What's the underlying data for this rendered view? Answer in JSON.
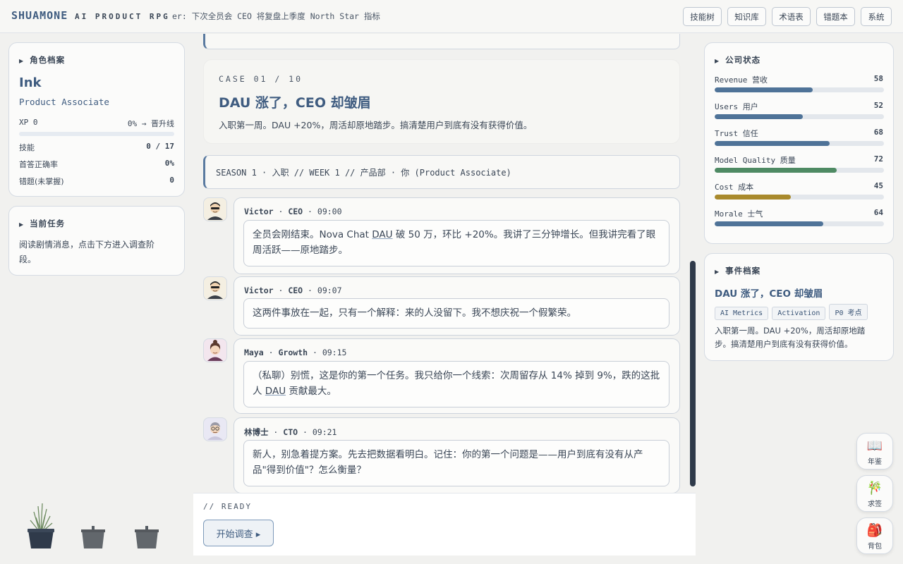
{
  "topbar": {
    "brand": "SHUAMONE",
    "brand_sub": "AI PRODUCT RPG",
    "ticker": "er: 下次全员会 CEO 将复盘上季度 North Star 指标",
    "buttons": [
      "技能树",
      "知识库",
      "术语表",
      "错题本",
      "系统"
    ]
  },
  "profile": {
    "title": "角色档案",
    "name": "Ink",
    "role": "Product Associate",
    "xp_label": "XP 0",
    "xp_progress": "0% → 晋升线",
    "xp_fraction": 0,
    "rows": [
      {
        "label": "技能",
        "value": "0 / 17"
      },
      {
        "label": "首答正确率",
        "value": "0%"
      },
      {
        "label": "错题(未掌握)",
        "value": "0"
      }
    ]
  },
  "task": {
    "title": "当前任务",
    "text": "阅读剧情消息，点击下方进入调查阶段。"
  },
  "case": {
    "number": "CASE 01 / 10",
    "title": "DAU 涨了，CEO 却皱眉",
    "desc": "入职第一周。DAU +20%，周活却原地踏步。搞清楚用户到底有没有获得价值。"
  },
  "season": "SEASON 1 · 入职 // WEEK 1 // 产品部 · 你 (Product Associate)",
  "messages": [
    {
      "name": "Victor",
      "dept": "CEO",
      "time": "09:00",
      "avatar": "victor-avatar",
      "text_a": "全员会刚结束。Nova Chat ",
      "text_u": "DAU",
      "text_b": " 破 50 万，环比 +20%。我讲了三分钟增长。但我讲完看了眼周活跃——原地踏步。"
    },
    {
      "name": "Victor",
      "dept": "CEO",
      "time": "09:07",
      "avatar": "victor-avatar",
      "text_a": "这两件事放在一起，只有一个解释：来的人没留下。我不想庆祝一个假繁荣。",
      "text_u": "",
      "text_b": ""
    },
    {
      "name": "Maya",
      "dept": "Growth",
      "time": "09:15",
      "avatar": "maya-avatar",
      "text_a": "（私聊）别慌，这是你的第一个任务。我只给你一个线索：次周留存从 14% 掉到 9%，跌的这批人 ",
      "text_u": "DAU",
      "text_b": " 贡献最大。"
    },
    {
      "name": "林博士",
      "dept": "CTO",
      "time": "09:21",
      "avatar": "lin-avatar",
      "text_a": "新人，别急着提方案。先去把数据看明白。记住：你的第一个问题是——用户到底有没有从产品\"得到价值\"？怎么衡量？",
      "text_u": "",
      "text_b": ""
    }
  ],
  "footer": {
    "status": "// READY",
    "start_button": "开始调查 ▸"
  },
  "company": {
    "title": "公司状态",
    "metrics": [
      {
        "label": "Revenue 营收",
        "value": 58,
        "color": "#4f7398"
      },
      {
        "label": "Users 用户",
        "value": 52,
        "color": "#4f7398"
      },
      {
        "label": "Trust 信任",
        "value": 68,
        "color": "#4f7398"
      },
      {
        "label": "Model Quality 质量",
        "value": 72,
        "color": "#4e8a63"
      },
      {
        "label": "Cost 成本",
        "value": 45,
        "color": "#a98a2c"
      },
      {
        "label": "Morale 士气",
        "value": 64,
        "color": "#4f7398"
      }
    ]
  },
  "event": {
    "title": "事件档案",
    "case_title": "DAU 涨了，CEO 却皱眉",
    "tags": [
      "AI Metrics",
      "Activation",
      "P0 考点"
    ],
    "desc": "入职第一周。DAU +20%，周活却原地踏步。搞清楚用户到底有没有获得价值。"
  },
  "side_buttons": [
    {
      "icon": "📖",
      "label": "年鉴",
      "icon_name": "book-icon"
    },
    {
      "icon": "🎋",
      "label": "求签",
      "icon_name": "fortune-stick-icon"
    },
    {
      "icon": "🎒",
      "label": "背包",
      "icon_name": "backpack-icon"
    }
  ]
}
